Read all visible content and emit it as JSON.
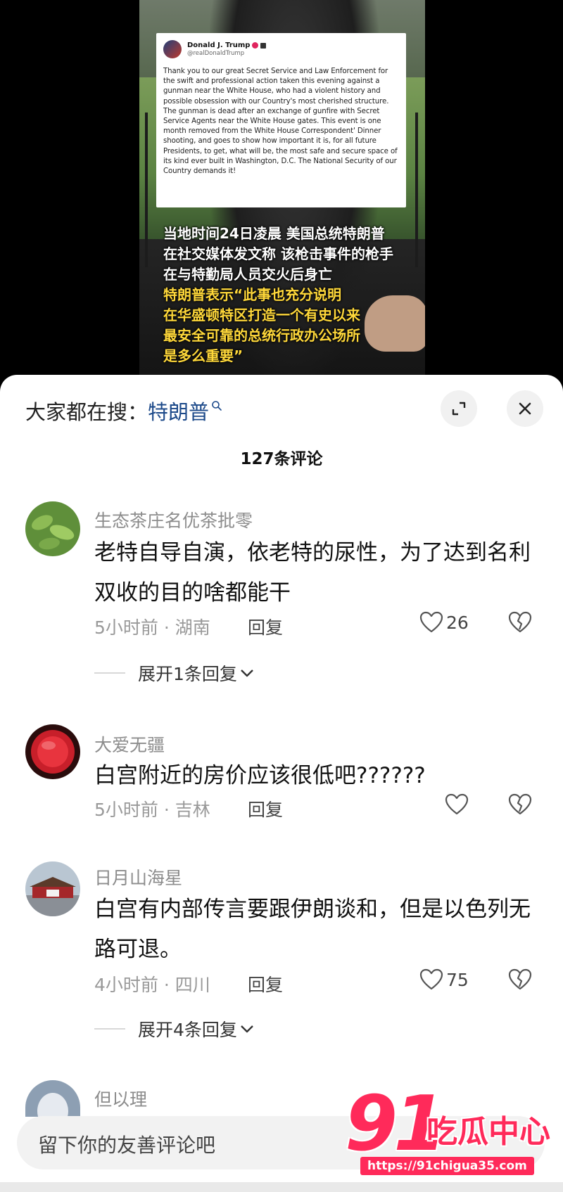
{
  "video": {
    "tweet": {
      "name": "Donald J. Trump",
      "handle": "@realDonaldTrump",
      "body": "Thank you to our great Secret Service and Law Enforcement for the swift and professional action taken this evening against a gunman near the White House, who had a violent history and possible obsession with our Country's most cherished structure. The gunman is dead after an exchange of gunfire with Secret Service Agents near the White House gates. This event is one month removed from the White House Correspondent' Dinner shooting, and goes to show how important it is, for all future Presidents, to get, what will be, the most safe and secure space of its kind ever built in Washington, D.C. The National Security of our Country demands it!"
    },
    "caption_white": [
      "当地时间24日凌晨 美国总统特朗普",
      "在社交媒体发文称 该枪击事件的枪手",
      "在与特勤局人员交火后身亡"
    ],
    "caption_yellow": [
      "特朗普表示“此事也充分说明",
      "在华盛顿特区打造一个有史以来",
      "最安全可靠的总统行政办公场所",
      "是多么重要”"
    ]
  },
  "sheet": {
    "search_prefix": "大家都在搜：",
    "search_term": "特朗普",
    "comments_title": "127条评论",
    "input_placeholder": "留下你的友善评论吧"
  },
  "comments": [
    {
      "user": "生态茶庄名优茶批零",
      "text": "老特自导自演，依老特的尿性，为了达到名利双收的目的啥都能干",
      "meta": "5小时前 · 湖南",
      "reply": "回复",
      "likes": "26",
      "expand": "展开1条回复"
    },
    {
      "user": "大爱无疆",
      "text": "白宫附近的房价应该很低吧??????",
      "meta": "5小时前 · 吉林",
      "reply": "回复",
      "likes": "",
      "expand": ""
    },
    {
      "user": "日月山海星",
      "text": "白宫有内部传言要跟伊朗谈和，但是以色列无路可退。",
      "meta": "4小时前 · 四川",
      "reply": "回复",
      "likes": "75",
      "expand": "展开4条回复"
    },
    {
      "user": "但以理",
      "text": "",
      "meta": "",
      "reply": "",
      "likes": "",
      "expand": ""
    }
  ],
  "watermark": {
    "num": "91",
    "cn": "吃瓜中心",
    "url": "https://91chigua35.com"
  },
  "colors": {
    "accent_blue": "#1d4a8a",
    "caption_yellow": "#ffd83a",
    "watermark_pink": "#ff2a5a"
  },
  "icons": {
    "expand": "expand-arrows-icon",
    "close": "close-icon",
    "like": "heart-icon",
    "dislike": "broken-heart-icon",
    "chevron": "chevron-down-icon",
    "search": "search-icon"
  }
}
